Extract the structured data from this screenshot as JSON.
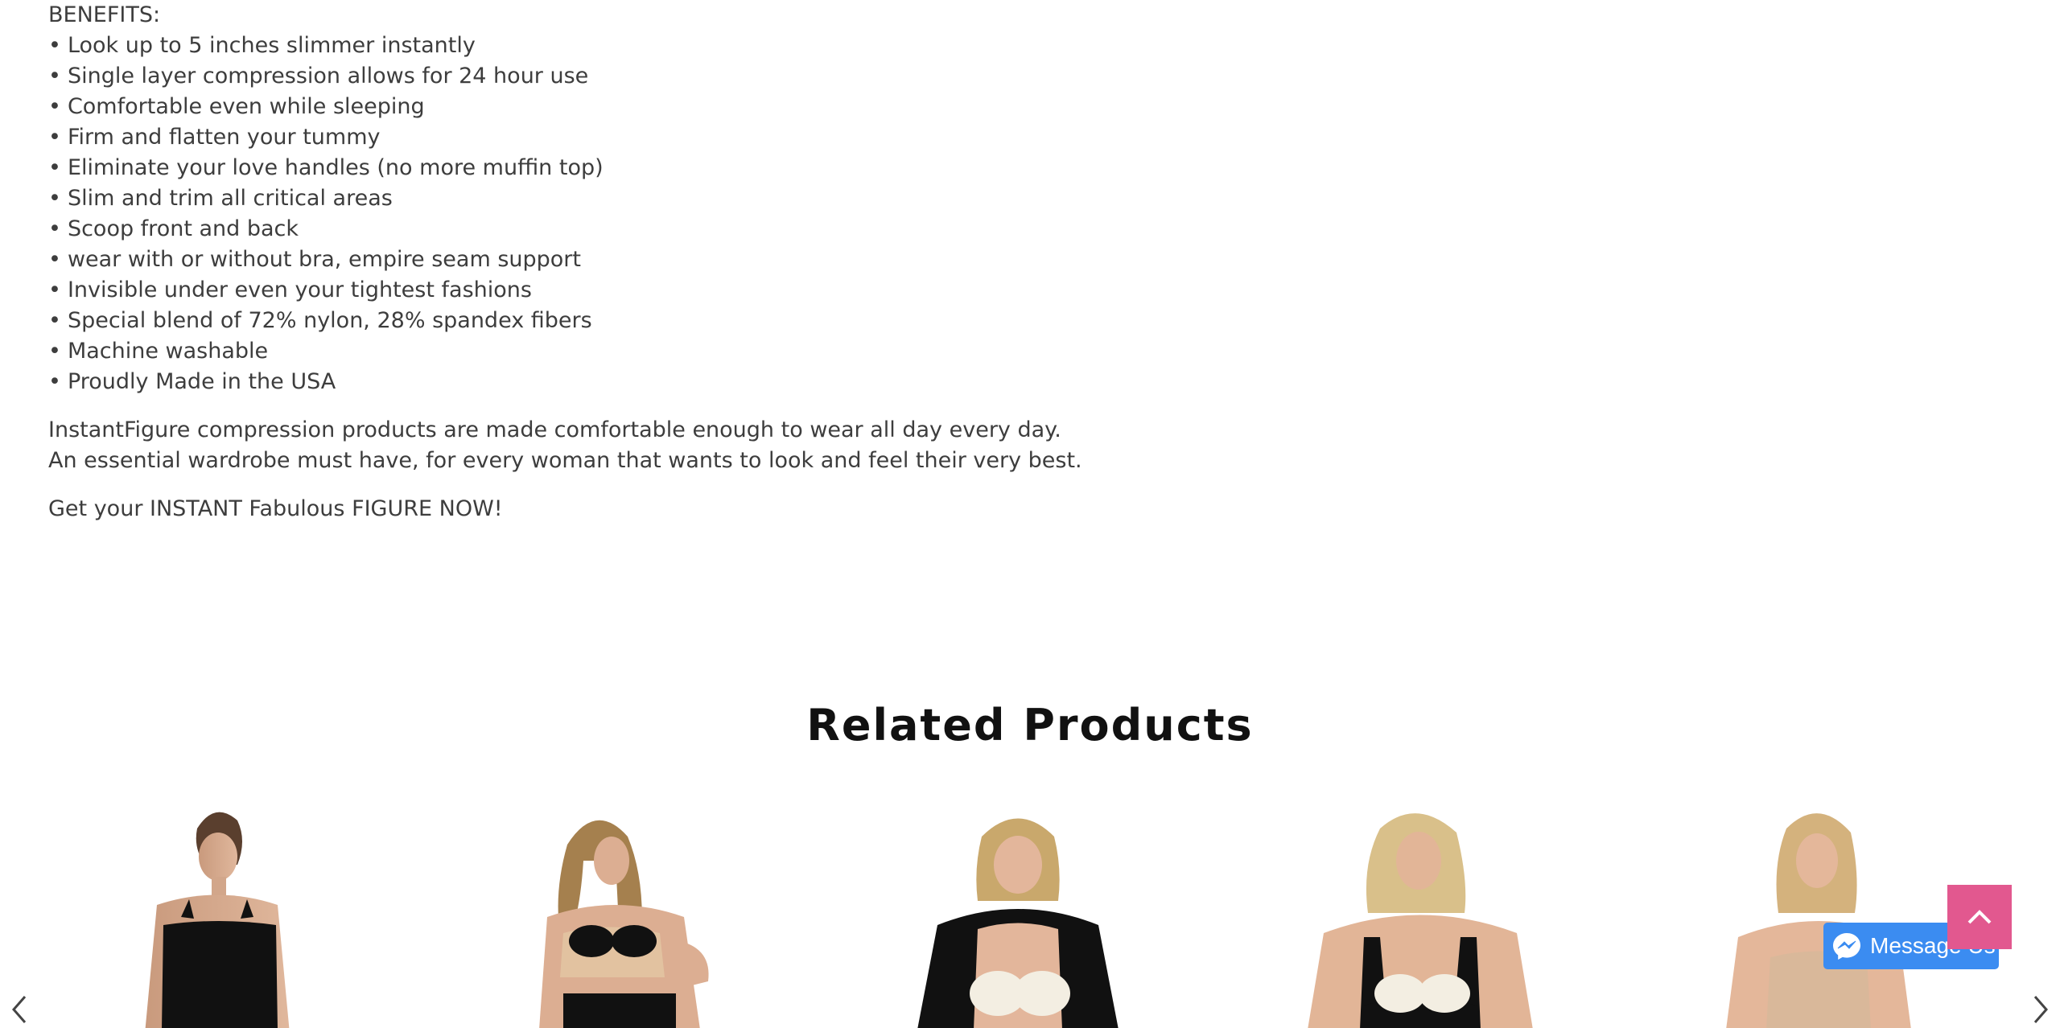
{
  "description": {
    "benefits_heading": "BENEFITS:",
    "benefits": [
      "Look up to 5 inches slimmer instantly",
      "Single layer compression allows for 24 hour use",
      "Comfortable even while sleeping",
      "Firm and flatten your tummy",
      "Eliminate your love handles (no more muffin top)",
      "Slim and trim all critical areas",
      "Scoop front and back",
      "wear with or without bra, empire seam support",
      "Invisible under even your tightest fashions",
      "Special blend of 72% nylon, 28% spandex fibers",
      "Machine washable",
      "Proudly Made in the USA"
    ],
    "paragraph_line1": "InstantFigure compression products are made comfortable enough to wear all day every day.",
    "paragraph_line2": "An essential wardrobe must have, for every woman that wants to look and feel their very best.",
    "cta": "Get your INSTANT Fabulous FIGURE NOW!"
  },
  "related": {
    "title": "Related Products"
  },
  "widgets": {
    "messenger_label": "Message Us"
  },
  "colors": {
    "text": "#3d3d3d",
    "heading": "#111111",
    "messenger": "#3b8cf1",
    "back_to_top": "#e2588f"
  }
}
